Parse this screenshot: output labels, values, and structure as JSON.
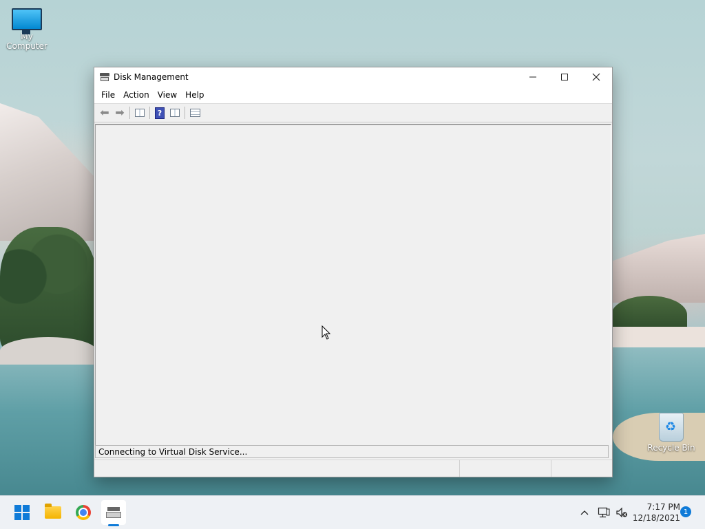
{
  "desktop": {
    "icons": [
      {
        "label": "My Computer"
      },
      {
        "label": "Recycle Bin"
      }
    ]
  },
  "window": {
    "title": "Disk Management",
    "controls": {
      "minimize": "—",
      "maximize": "☐",
      "close": "✕"
    },
    "menu": [
      "File",
      "Action",
      "View",
      "Help"
    ],
    "toolbar_icons": [
      "back-icon",
      "forward-icon",
      "show-hide-console-tree-icon",
      "help-icon",
      "show-hide-action-pane-icon",
      "properties-icon"
    ],
    "status_message": "Connecting to Virtual Disk Service..."
  },
  "taskbar": {
    "apps": [
      "start-icon",
      "file-explorer-icon",
      "chrome-icon",
      "disk-management-icon"
    ],
    "clock": {
      "time": "7:17 PM",
      "date": "12/18/2021"
    },
    "notification_count": "1"
  }
}
